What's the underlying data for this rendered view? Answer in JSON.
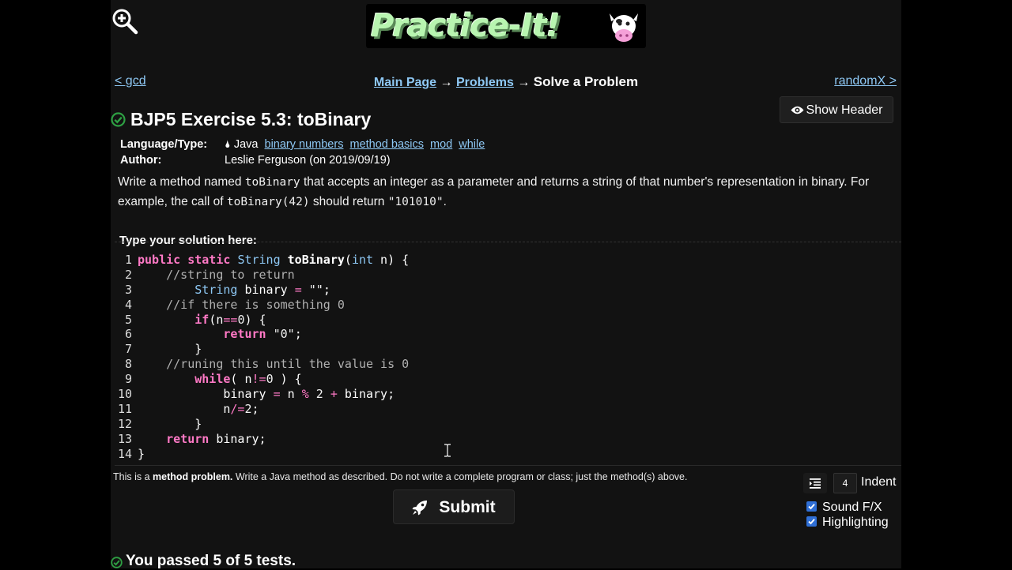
{
  "logo": {
    "text": "Practice-It!"
  },
  "nav": {
    "prev": "< gcd",
    "next": "randomX >",
    "breadcrumb": {
      "main": "Main Page",
      "sep": "→",
      "problems": "Problems",
      "current": "Solve a Problem"
    }
  },
  "show_header_label": "Show Header",
  "problem": {
    "title": "BJP5 Exercise 5.3: toBinary",
    "language_label": "Language/Type:",
    "language": "Java",
    "tags": [
      "binary numbers",
      "method basics",
      "mod",
      "while"
    ],
    "author_label": "Author:",
    "author": "Leslie Ferguson (on 2019/09/19)",
    "desc": {
      "p1": "Write a method named ",
      "c1": "toBinary",
      "p2": " that accepts an integer as a parameter and returns a string of that number's representation in binary. For example, the call of ",
      "c2": "toBinary(42)",
      "p3": " should return ",
      "c3": "\"101010\"",
      "p4": "."
    }
  },
  "editor": {
    "label": "Type your solution here:",
    "line_numbers": [
      "1",
      "2",
      "3",
      "4",
      "5",
      "6",
      "7",
      "8",
      "9",
      "10",
      "11",
      "12",
      "13",
      "14"
    ]
  },
  "note": {
    "pre": "This is a ",
    "bold": "method problem.",
    "post": " Write a Java method as described. Do not write a complete program or class; just the method(s) above."
  },
  "indent": {
    "value": "4",
    "label": "Indent"
  },
  "submit_label": "Submit",
  "options": {
    "sound": "Sound F/X",
    "highlighting": "Highlighting"
  },
  "result": "You passed 5 of 5 tests.",
  "colors": {
    "link": "#8ec8f4",
    "check": "#2ea043",
    "keyword": "#ff79c6",
    "type": "#8ec8f4",
    "checkbox": "#2f6fd6"
  }
}
